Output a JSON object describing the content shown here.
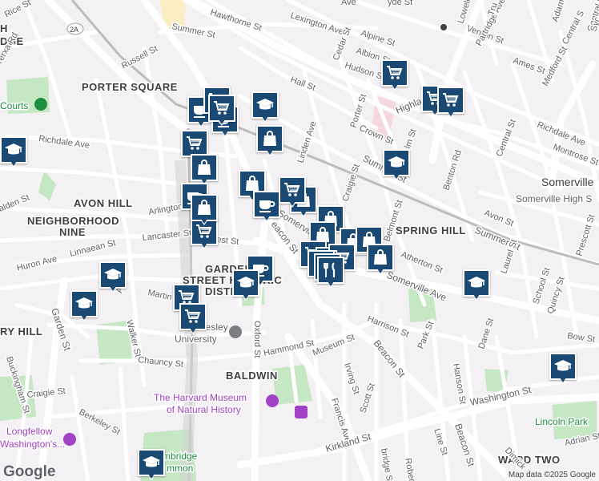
{
  "map": {
    "attribution": "Map data ©2025 Google",
    "logo": "Google",
    "colors": {
      "background": "#f3f1f4",
      "road": "#ffffff",
      "park": "#c6e7c3",
      "marker": "#1a4a74",
      "rail": "#b9b9b9"
    },
    "labels": {
      "neighborhoods": {
        "porter_square": "PORTER SQUARE",
        "avon_hill": "AVON HILL",
        "neighborhood_nine_1": "NEIGHBORHOOD",
        "neighborhood_nine_2": "NINE",
        "spring_hill": "SPRING HILL",
        "garden_street_1": "GARDEN",
        "garden_street_2": "STREET HISTORIC",
        "garden_street_3": "DISTRICT",
        "baldwin": "BALDWIN",
        "ward_two": "WARD TWO",
        "ry_hill": "RY HILL",
        "hbridge": "H",
        "hbridge2": "DGE"
      },
      "city": "Somerville",
      "school": "Somerville High S",
      "pois": {
        "harvard_museum_1": "The Harvard Museum",
        "harvard_museum_2": "of Natural History",
        "longfellow_1": "Longfellow",
        "longfellow_2": "Washington's...",
        "lesley_1": "Lesley",
        "lesley_2": "University",
        "courts": "Courts",
        "lincoln_park": "Lincoln Park",
        "cambridge_common_1": "mbridge",
        "cambridge_common_2": "mmon"
      },
      "streets": {
        "summer_st_top": "Summer St",
        "hawthorne_st": "Hawthorne St",
        "lexington_ave": "Lexington Ave",
        "alpine_st": "Alpine St",
        "albion_st": "Albion St",
        "hudson_st": "Hudson St",
        "cedar_st": "Cedar St",
        "lowell_st": "Lowell St",
        "vernon_st": "Vernon St",
        "partridge_ave": "Partridge Ave",
        "ames_st": "Ames St",
        "medford_st": "Medford St",
        "central_st_top": "Central S",
        "russell_st": "Russell St",
        "rice_st": "Rice St",
        "yerxa_rd": "Yerxa Rd",
        "hall_st": "Hall St",
        "highland_ave": "Highland Ave",
        "porter_st": "Porter St",
        "crown_st": "Crown St",
        "elm_st": "lm St",
        "richdale_ave_left": "Richdale Ave",
        "richdale_ave_right": "Richdale Ave",
        "central_st": "Central St",
        "montrose_st": "Montrose St",
        "linden_ave": "Linden Ave",
        "summer_st_mid": "Summer St",
        "benton_rd": "Benton Rd",
        "craigie_st_top": "Craigie St",
        "belmont_st": "Belmont St",
        "avon_st_right": "Avon St",
        "summer_st_right": "Summer St",
        "prescott_st": "Prescott St",
        "laurel_st": "Laurel St",
        "school_st": "School St",
        "quincy_st": "Quincy St",
        "bow_st": "Bow St",
        "arlington_st": "Arlington St",
        "lancaster_st": "Lancaster St",
        "forest_st": "est St",
        "beacon_st_mid": "eacon St",
        "somerville_ave_mid": "Somerville",
        "atherton_st": "Atherton St",
        "somerville_ave_right": "Somerville Ave",
        "harrison_st": "Harrison St",
        "beacon_st_low": "Beacon St",
        "park_st": "Park St",
        "dane_st": "Dane St",
        "hanson_st": "Hanson St",
        "linnaean_st": "Linnaean St",
        "huron_ave": "Huron Ave",
        "alden_st": "alden St",
        "martin_st": "Martin St",
        "avon_st_left": "Avon St",
        "walker_st": "Walker St",
        "garden_st": "Garden St",
        "buckingham_st": "Buckingham St",
        "oxford_st": "Oxford St",
        "hammond_st": "Hammond St",
        "museum_st": "Museum St",
        "irving_st": "Irving St",
        "francis_ave": "Francis Ave",
        "scott_st": "Scott St",
        "chauncy_st": "Chauncy St",
        "craigie_st_low": "Craigie St",
        "berkeley_st": "Berkeley St",
        "washington_st": "Washington St",
        "kirkland_st": "Kirkland St",
        "cambridge_st": "bridge St",
        "roberts_rd": "Roberts Rd",
        "line_st": "Line St",
        "beacon_st_bottom": "Beacon St",
        "dimick_st": "Dimick St",
        "adrian_st": "Adrian St",
        "hyde_st": "yde St",
        "ave_top": "Ave",
        "trull": "Tru",
        "adam": "Adam",
        "central_far": "Central S",
        "sycamore": "Syc",
        "route_2a": "2A"
      }
    },
    "markers": [
      {
        "type": "cart"
      },
      {
        "type": "cart"
      },
      {
        "type": "cart"
      },
      {
        "type": "cart"
      },
      {
        "type": "school"
      },
      {
        "type": "school"
      },
      {
        "type": "cafe"
      },
      {
        "type": "cafe"
      },
      {
        "type": "bag"
      },
      {
        "type": "bag"
      },
      {
        "type": "cart"
      },
      {
        "type": "cart"
      },
      {
        "type": "school"
      },
      {
        "type": "bag"
      },
      {
        "type": "bag"
      },
      {
        "type": "bag"
      },
      {
        "type": "cafe"
      },
      {
        "type": "cafe"
      },
      {
        "type": "cart"
      },
      {
        "type": "bag"
      },
      {
        "type": "bag"
      },
      {
        "type": "bag"
      },
      {
        "type": "cart"
      },
      {
        "type": "cart"
      },
      {
        "type": "cart"
      },
      {
        "type": "cart"
      },
      {
        "type": "bag"
      },
      {
        "type": "restaurant"
      },
      {
        "type": "restaurant"
      },
      {
        "type": "restaurant"
      },
      {
        "type": "cafe"
      },
      {
        "type": "school"
      },
      {
        "type": "school"
      },
      {
        "type": "school"
      },
      {
        "type": "cart"
      },
      {
        "type": "cart"
      },
      {
        "type": "school"
      },
      {
        "type": "school"
      },
      {
        "type": "school"
      },
      {
        "type": "bag"
      }
    ]
  }
}
